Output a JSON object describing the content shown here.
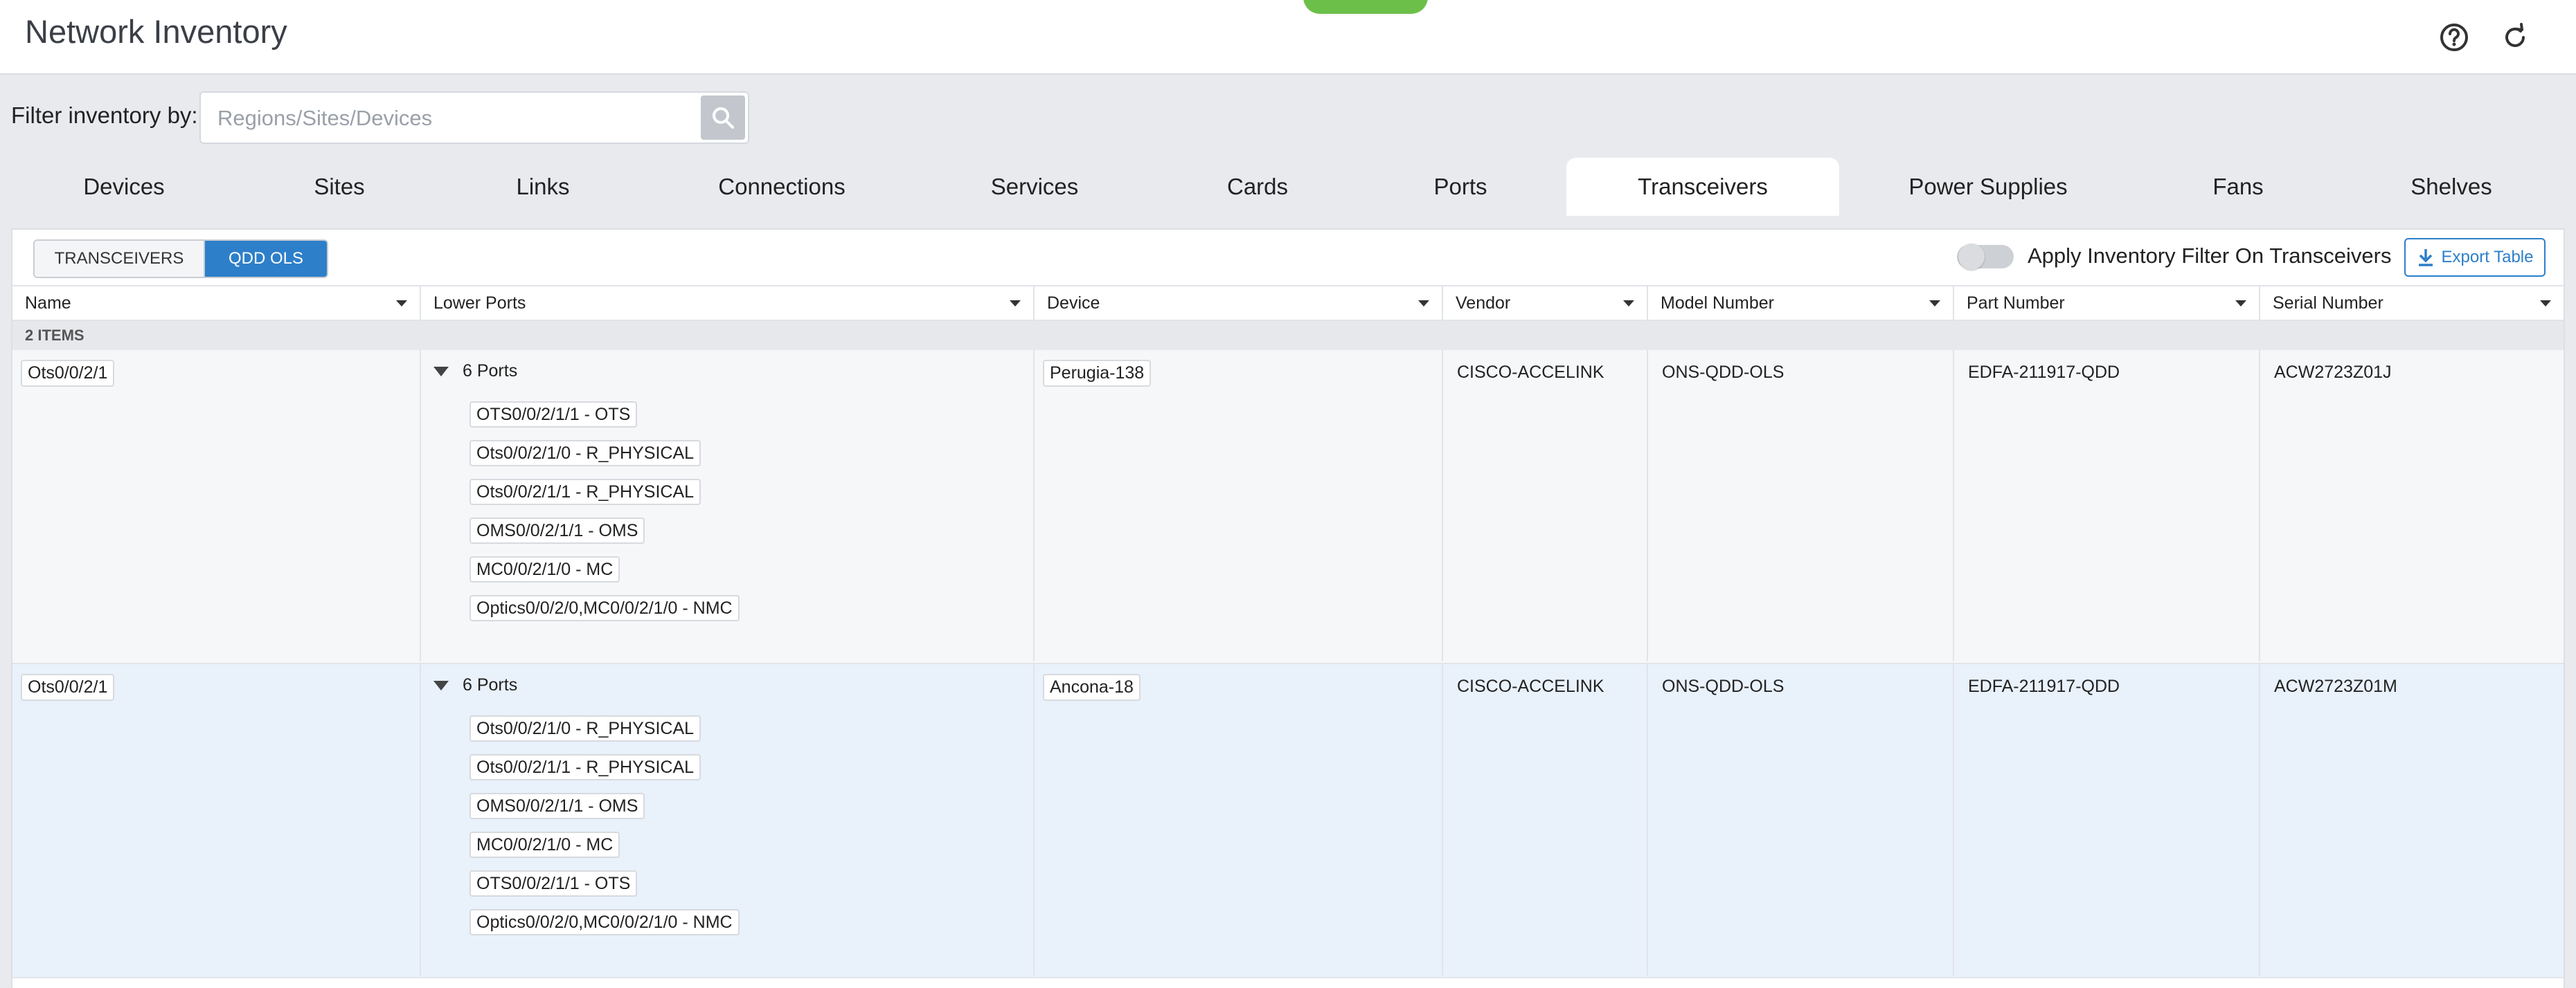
{
  "app": {
    "title": "Network Inventory"
  },
  "filter": {
    "label": "Filter inventory by:",
    "placeholder": "Regions/Sites/Devices",
    "value": ""
  },
  "tabs": [
    {
      "label": "Devices"
    },
    {
      "label": "Sites"
    },
    {
      "label": "Links"
    },
    {
      "label": "Connections"
    },
    {
      "label": "Services"
    },
    {
      "label": "Cards"
    },
    {
      "label": "Ports"
    },
    {
      "label": "Transceivers",
      "active": true
    },
    {
      "label": "Power Supplies"
    },
    {
      "label": "Fans"
    },
    {
      "label": "Shelves"
    }
  ],
  "subview": {
    "options": [
      {
        "label": "TRANSCEIVERS"
      },
      {
        "label": "QDD OLS"
      }
    ],
    "selected": "QDD OLS"
  },
  "toolbar": {
    "apply_filter_label": "Apply Inventory Filter On Transceivers",
    "apply_filter_on": false,
    "export_label": "Export Table"
  },
  "table": {
    "columns": [
      "Name",
      "Lower Ports",
      "Device",
      "Vendor",
      "Model Number",
      "Part Number",
      "Serial Number"
    ],
    "count_label": "2 ITEMS",
    "rows": [
      {
        "name": "Ots0/0/2/1",
        "ports_label": "6 Ports",
        "ports": [
          "OTS0/0/2/1/1 - OTS",
          "Ots0/0/2/1/0 - R_PHYSICAL",
          "Ots0/0/2/1/1 - R_PHYSICAL",
          "OMS0/0/2/1/1 - OMS",
          "MC0/0/2/1/0 - MC",
          "Optics0/0/2/0,MC0/0/2/1/0 - NMC"
        ],
        "device": "Perugia-138",
        "vendor": "CISCO-ACCELINK",
        "model": "ONS-QDD-OLS",
        "part": "EDFA-211917-QDD",
        "serial": "ACW2723Z01J"
      },
      {
        "name": "Ots0/0/2/1",
        "ports_label": "6 Ports",
        "ports": [
          "Ots0/0/2/1/0 - R_PHYSICAL",
          "Ots0/0/2/1/1 - R_PHYSICAL",
          "OMS0/0/2/1/1 - OMS",
          "MC0/0/2/1/0 - MC",
          "OTS0/0/2/1/1 - OTS",
          "Optics0/0/2/0,MC0/0/2/1/0 - NMC"
        ],
        "device": "Ancona-18",
        "vendor": "CISCO-ACCELINK",
        "model": "ONS-QDD-OLS",
        "part": "EDFA-211917-QDD",
        "serial": "ACW2723Z01M"
      }
    ]
  }
}
